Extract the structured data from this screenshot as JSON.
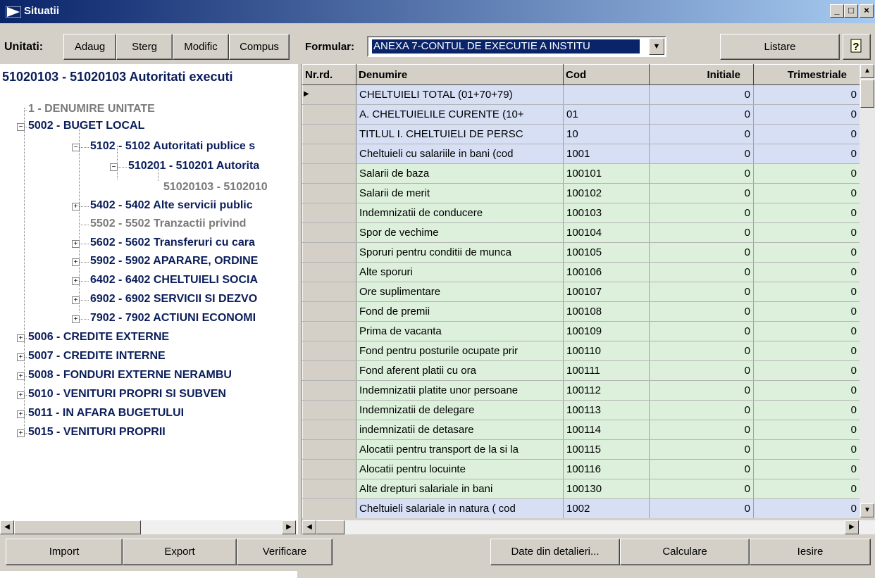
{
  "window": {
    "title": "Situatii",
    "min_label": "_",
    "max_label": "□",
    "close_label": "×"
  },
  "toolbar": {
    "unitati_label": "Unitati:",
    "adaug": "Adaug",
    "sterg": "Sterg",
    "modific": "Modific",
    "compus": "Compus",
    "formular_label": "Formular:",
    "formular_value": "ANEXA 7-CONTUL DE EXECUTIE A INSTITU",
    "listare": "Listare"
  },
  "tree": {
    "header": "51020103 - 51020103 Autoritati executi",
    "nodes": [
      "1 - DENUMIRE UNITATE",
      "5002 - BUGET LOCAL",
      "5102 - 5102 Autoritati publice s",
      "510201 - 510201 Autorita",
      "51020103 - 5102010",
      "5402 - 5402 Alte servicii public",
      "5502 - 5502 Tranzactii privind",
      "5602 - 5602 Transferuri cu cara",
      "5902 - 5902 APARARE, ORDINE",
      "6402 - 6402 CHELTUIELI SOCIA",
      "6902 - 6902 SERVICII SI DEZVO",
      "7902 - 7902 ACTIUNI ECONOMI",
      "5006 - CREDITE EXTERNE",
      "5007 - CREDITE INTERNE",
      "5008 - FONDURI EXTERNE NERAMBU",
      "5010 - VENITURI PROPRI SI SUBVEN",
      "5011 - IN AFARA BUGETULUI",
      "5015 - VENITURI PROPRII"
    ]
  },
  "grid": {
    "columns": [
      "Nr.rd.",
      "Denumire",
      "Cod",
      "Initiale",
      "Trimestriale"
    ],
    "rows": [
      {
        "den": "CHELTUIELI TOTAL (01+70+79)",
        "cod": "",
        "ini": "0",
        "tri": "0",
        "c": "b"
      },
      {
        "den": "A. CHELTUIELILE CURENTE (10+",
        "cod": "01",
        "ini": "0",
        "tri": "0",
        "c": "b"
      },
      {
        "den": "TITLUL I. CHELTUIELI DE PERSC",
        "cod": "10",
        "ini": "0",
        "tri": "0",
        "c": "b"
      },
      {
        "den": "Cheltuieli cu salariile in bani (cod",
        "cod": "1001",
        "ini": "0",
        "tri": "0",
        "c": "b"
      },
      {
        "den": "Salarii de baza",
        "cod": "100101",
        "ini": "0",
        "tri": "0",
        "c": "g"
      },
      {
        "den": "Salarii de merit",
        "cod": "100102",
        "ini": "0",
        "tri": "0",
        "c": "g"
      },
      {
        "den": "Indemnizatii de conducere",
        "cod": "100103",
        "ini": "0",
        "tri": "0",
        "c": "g"
      },
      {
        "den": "Spor de vechime",
        "cod": "100104",
        "ini": "0",
        "tri": "0",
        "c": "g"
      },
      {
        "den": "Sporuri pentru conditii de munca",
        "cod": "100105",
        "ini": "0",
        "tri": "0",
        "c": "g"
      },
      {
        "den": "Alte sporuri",
        "cod": "100106",
        "ini": "0",
        "tri": "0",
        "c": "g"
      },
      {
        "den": "Ore suplimentare",
        "cod": "100107",
        "ini": "0",
        "tri": "0",
        "c": "g"
      },
      {
        "den": "Fond de premii",
        "cod": "100108",
        "ini": "0",
        "tri": "0",
        "c": "g"
      },
      {
        "den": "Prima de vacanta",
        "cod": "100109",
        "ini": "0",
        "tri": "0",
        "c": "g"
      },
      {
        "den": "Fond pentru posturile ocupate prir",
        "cod": "100110",
        "ini": "0",
        "tri": "0",
        "c": "g"
      },
      {
        "den": "Fond aferent platii cu ora",
        "cod": "100111",
        "ini": "0",
        "tri": "0",
        "c": "g"
      },
      {
        "den": "Indemnizatii platite unor persoane",
        "cod": "100112",
        "ini": "0",
        "tri": "0",
        "c": "g"
      },
      {
        "den": "Indemnizatii de delegare",
        "cod": "100113",
        "ini": "0",
        "tri": "0",
        "c": "g"
      },
      {
        "den": "indemnizatii de detasare",
        "cod": "100114",
        "ini": "0",
        "tri": "0",
        "c": "g"
      },
      {
        "den": "Alocatii pentru transport de la si la",
        "cod": "100115",
        "ini": "0",
        "tri": "0",
        "c": "g"
      },
      {
        "den": "Alocatii pentru locuinte",
        "cod": "100116",
        "ini": "0",
        "tri": "0",
        "c": "g"
      },
      {
        "den": "Alte drepturi salariale in bani",
        "cod": "100130",
        "ini": "0",
        "tri": "0",
        "c": "g"
      },
      {
        "den": "Cheltuieli salariale in natura ( cod",
        "cod": "1002",
        "ini": "0",
        "tri": "0",
        "c": "b"
      }
    ]
  },
  "footer": {
    "import": "Import",
    "export": "Export",
    "verificare": "Verificare",
    "date_detalieri": "Date din detalieri...",
    "calculare": "Calculare",
    "iesire": "Iesire"
  },
  "colors": {
    "row_blue": "#d6dff4",
    "row_green": "#dcf0dc",
    "title_start": "#0a246a",
    "title_end": "#a6caf0"
  }
}
